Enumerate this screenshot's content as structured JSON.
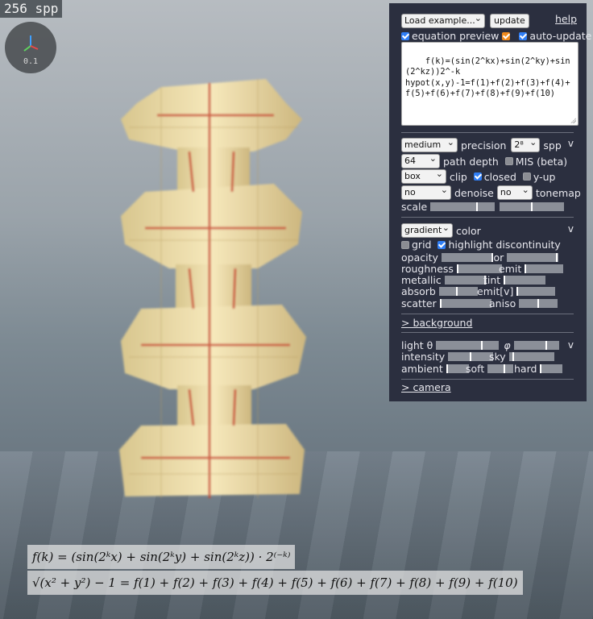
{
  "status": {
    "spp_label": "256 spp"
  },
  "axes_widget": {
    "scale_label": "0.1"
  },
  "panel": {
    "example_select": "Load example...",
    "update_button": "update",
    "help_link": "help",
    "equation_preview_label": "equation preview",
    "equation_preview_checked": true,
    "equation_preview_color_checked": true,
    "auto_update_label": "auto-update",
    "auto_update_checked": true,
    "equation_text": "f(k)=(sin(2^kx)+sin(2^ky)+sin(2^kz))2^-k\nhypot(x,y)-1=f(1)+f(2)+f(3)+f(4)+f(5)+f(6)+f(7)+f(8)+f(9)+f(10)",
    "render": {
      "precision_select": "medium",
      "precision_label": "precision",
      "spp_select": "2⁸",
      "spp_label": "spp",
      "collapse_mark": "v",
      "path_depth_select": "64",
      "path_depth_label": "path depth",
      "mis_label": "MIS (beta)",
      "mis_checked": false,
      "clip_select": "box",
      "clip_label": "clip",
      "closed_label": "closed",
      "closed_checked": true,
      "yup_label": "y-up",
      "yup_checked": false,
      "denoise_select": "no",
      "denoise_label": "denoise",
      "tonemap_select": "no",
      "tonemap_label": "tonemap",
      "scale_label": "scale",
      "scale_value_1": 0.72,
      "scale_value_2": 0.5
    },
    "material": {
      "color_select": "gradient",
      "color_label": "color",
      "collapse_mark": "v",
      "grid_label": "grid",
      "grid_checked": false,
      "highlight_label": "highlight discontinuity",
      "highlight_checked": true,
      "opacity_label": "opacity",
      "opacity_value": 1.0,
      "ior_label": "ior",
      "ior_value": 0.96,
      "roughness_label": "roughness",
      "roughness_value": 0.0,
      "emit_label": "emit",
      "emit_value": 0.0,
      "metallic_label": "metallic",
      "metallic_value": 0.96,
      "tint_label": "tint",
      "tint_value": 0.0,
      "absorb_label": "absorb",
      "absorb_value": 0.47,
      "emitv_label": "emit[v]",
      "emitv_value": 0.0,
      "scatter_label": "scatter",
      "scatter_value": 0.0,
      "aniso_label": "aniso",
      "aniso_value": 0.5
    },
    "background_link": "> background",
    "lighting": {
      "light_theta_label": "light θ",
      "light_theta_value": 0.73,
      "light_phi_label": "φ",
      "light_phi_value": 0.73,
      "collapse_mark": "v",
      "intensity_label": "intensity",
      "intensity_value": 0.5,
      "sky_label": "sky",
      "sky_value": 0.1,
      "ambient_label": "ambient",
      "ambient_value": 0.0,
      "soft_label": "soft",
      "soft_value": 0.65,
      "hard_label": "hard",
      "hard_value": 0.0
    },
    "camera_link": "> camera"
  },
  "equation_overlay": {
    "line1": "f(k) = (sin(2ᵏx) + sin(2ᵏy) + sin(2ᵏz)) · 2⁽⁻ᵏ⁾",
    "line2": "√(x² + y²) − 1 = f(1) + f(2) + f(3) + f(4) + f(5) + f(6) + f(7) + f(8) + f(9) + f(10)"
  },
  "colors": {
    "panel_bg": "#2b2f3f",
    "checkbox_blue": "#2f7ef6",
    "checkbox_orange": "#f08a1c",
    "fractal_cream": "#f1e1ae",
    "fractal_red": "#c8412a"
  }
}
